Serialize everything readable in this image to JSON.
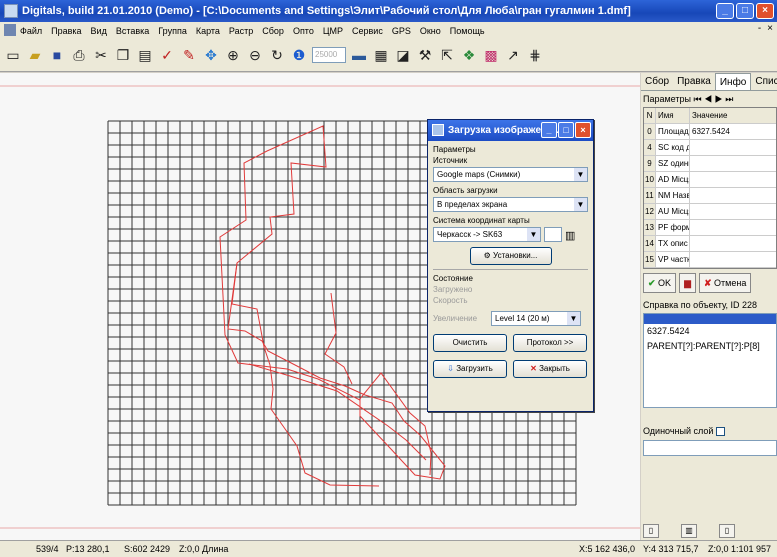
{
  "window": {
    "title": "Digitals, build 21.01.2010 (Demo) - [C:\\Documents and Settings\\Элит\\Рабочий стол\\Для Люба\\гран гугалмин 1.dmf]",
    "controls": [
      "_",
      "□",
      "×"
    ]
  },
  "menu": {
    "items": [
      "Файл",
      "Правка",
      "Вид",
      "Вставка",
      "Группа",
      "Карта",
      "Растр",
      "Сбор",
      "Опто",
      "ЦМР",
      "Сервис",
      "GPS",
      "Окно",
      "Помощь"
    ],
    "mdi_controls": [
      "-",
      "×"
    ]
  },
  "toolbar": {
    "buttons": [
      "new-icon",
      "open-icon",
      "save-icon",
      "print-icon",
      "cut-icon",
      "copy-icon",
      "paste-icon",
      "check-icon",
      "pencil-icon",
      "pan-icon",
      "zoom-in-icon",
      "zoom-out-icon",
      "refresh-icon",
      "info-icon",
      "monitor-icon",
      "table-icon",
      "layers-icon",
      "tool-icon",
      "select-icon",
      "map-icon",
      "image-icon",
      "line-icon",
      "grid-icon"
    ],
    "scale_value": "25000"
  },
  "dialog": {
    "title": "Загрузка изображени...",
    "controls": [
      "_",
      "□",
      "×"
    ],
    "params_label": "Параметры",
    "source_label": "Источник",
    "source_value": "Google maps (Снимки)",
    "area_label": "Область загрузки",
    "area_value": "В пределах экрана",
    "crs_label": "Система координат карты",
    "crs_value": "Черкасск -> SK63",
    "settings_button": "Установки...",
    "state_label": "Состояние",
    "loaded_label": "Загружено",
    "speed_label": "Скорость",
    "zoom_label": "Увеличение",
    "zoom_value": "Level 14 (20 м)",
    "clear_button": "Очистить",
    "protocol_button": "Протокол >>",
    "load_button": "Загрузить",
    "close_button": "Закрыть"
  },
  "side_panel": {
    "tabs": [
      "Сбор",
      "Правка",
      "Инфо",
      "Список"
    ],
    "active_tab": "Инфо",
    "params_label": "Параметры",
    "columns": [
      "N",
      "Имя",
      "Значение"
    ],
    "rows": [
      {
        "n": "0",
        "name": "Площадь",
        "value": "6327.5424"
      },
      {
        "n": "4",
        "name": "SC код д",
        "value": ""
      },
      {
        "n": "9",
        "name": "SZ одини",
        "value": ""
      },
      {
        "n": "10",
        "name": "AD Місця",
        "value": ""
      },
      {
        "n": "11",
        "name": "NM Назв",
        "value": ""
      },
      {
        "n": "12",
        "name": "AU Місця",
        "value": ""
      },
      {
        "n": "13",
        "name": "PF форми",
        "value": ""
      },
      {
        "n": "14",
        "name": "TX опис",
        "value": ""
      },
      {
        "n": "15",
        "name": "VP частк",
        "value": ""
      }
    ],
    "ok_button": "OK",
    "cancel_button": "Отмена",
    "info_label": "Справка по объекту, ID 228",
    "info_lines": [
      "6327.5424",
      "PARENT[?]:PARENT[?]:P[8]"
    ],
    "single_layer_label": "Одиночный слой"
  },
  "status": {
    "item_count": "539/4",
    "p_value": "P:13 280,1",
    "s_value": "S:602 2429",
    "z_label": "Z:0,0 Длина",
    "x_coord": "X:5 162 436,0",
    "y_coord": "Y:4 313 715,7",
    "z_scale": "Z:0,0 1:101 957"
  },
  "colors": {
    "title_blue": "#1747b8",
    "polygon_red": "#e03a3a",
    "grid_line": "#2a2a2a"
  }
}
